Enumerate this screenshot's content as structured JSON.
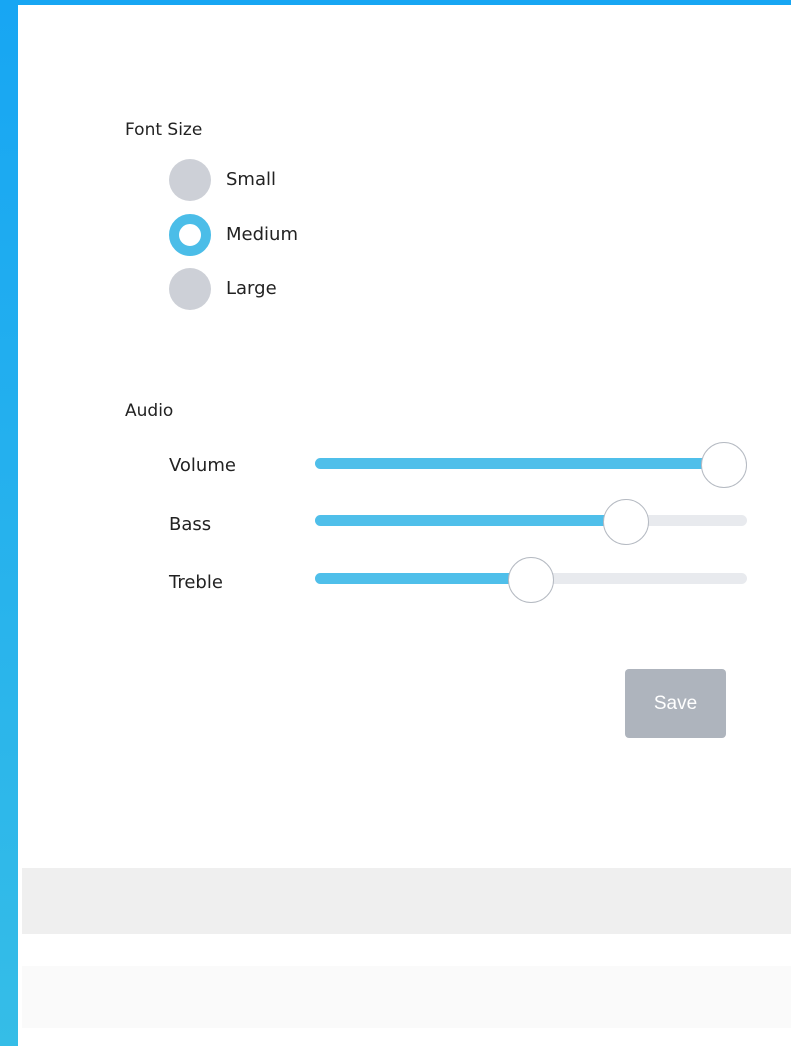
{
  "font_size": {
    "label": "Font Size",
    "selected": "Medium",
    "options": [
      {
        "label": "Small",
        "checked": false
      },
      {
        "label": "Medium",
        "checked": true
      },
      {
        "label": "Large",
        "checked": false
      }
    ]
  },
  "audio": {
    "label": "Audio",
    "sliders": [
      {
        "label": "Volume",
        "value": 0.95
      },
      {
        "label": "Bass",
        "value": 0.72
      },
      {
        "label": "Treble",
        "value": 0.5
      }
    ]
  },
  "actions": {
    "save_label": "Save"
  },
  "colors": {
    "accent": "#4fbfea",
    "radio_unchecked": "#cdd0d7",
    "slider_track": "#e8eaee",
    "button_disabled": "#aeb4bd",
    "window_frame": "#17a6f3"
  }
}
